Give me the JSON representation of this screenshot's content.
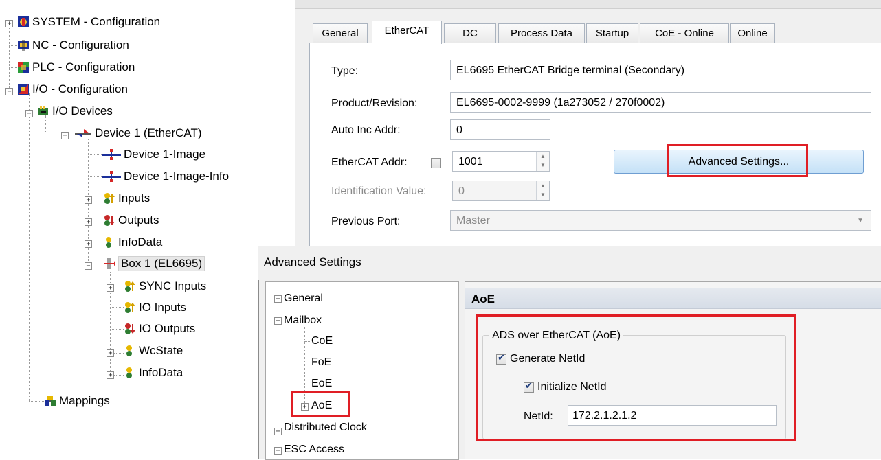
{
  "tree": {
    "items": [
      {
        "label": "SYSTEM - Configuration"
      },
      {
        "label": "NC - Configuration"
      },
      {
        "label": "PLC - Configuration"
      },
      {
        "label": "I/O - Configuration"
      },
      {
        "label": "I/O Devices"
      },
      {
        "label": "Device 1 (EtherCAT)"
      },
      {
        "label": "Device 1-Image"
      },
      {
        "label": "Device 1-Image-Info"
      },
      {
        "label": "Inputs"
      },
      {
        "label": "Outputs"
      },
      {
        "label": "InfoData"
      },
      {
        "label": "Box 1 (EL6695)"
      },
      {
        "label": "SYNC Inputs"
      },
      {
        "label": "IO Inputs"
      },
      {
        "label": "IO Outputs"
      },
      {
        "label": "WcState"
      },
      {
        "label": "InfoData"
      },
      {
        "label": "Mappings"
      }
    ]
  },
  "tabs": [
    "General",
    "EtherCAT",
    "DC",
    "Process Data",
    "Startup",
    "CoE - Online",
    "Online"
  ],
  "ethercat": {
    "type_label": "Type:",
    "type_value": "EL6695 EtherCAT Bridge terminal (Secondary)",
    "product_label": "Product/Revision:",
    "product_value": "EL6695-0002-9999 (1a273052 / 270f0002)",
    "autoinc_label": "Auto Inc Addr:",
    "autoinc_value": "0",
    "addr_label": "EtherCAT Addr:",
    "addr_value": "1001",
    "ident_label": "Identification Value:",
    "ident_value": "0",
    "prevport_label": "Previous Port:",
    "prevport_value": "Master",
    "advanced_button": "Advanced Settings..."
  },
  "dialog": {
    "title": "Advanced Settings",
    "tree": [
      {
        "label": "General"
      },
      {
        "label": "Mailbox"
      },
      {
        "label": "CoE"
      },
      {
        "label": "FoE"
      },
      {
        "label": "EoE"
      },
      {
        "label": "AoE"
      },
      {
        "label": "Distributed Clock"
      },
      {
        "label": "ESC Access"
      }
    ],
    "header": "AoE",
    "group_label": "ADS over EtherCAT (AoE)",
    "generate_netid": "Generate NetId",
    "initialize_netid": "Initialize NetId",
    "netid_label": "NetId:",
    "netid_value": "172.2.1.2.1.2"
  }
}
